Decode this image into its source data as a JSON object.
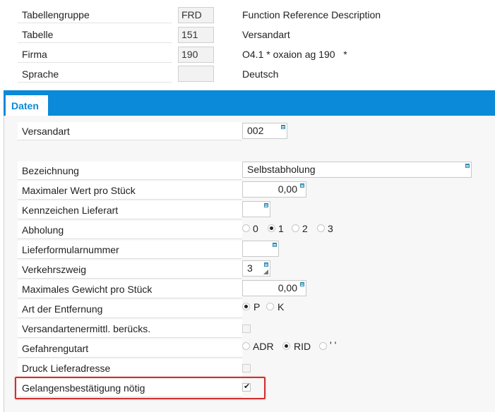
{
  "header": {
    "rows": [
      {
        "label": "Tabellengruppe",
        "value": "FRD",
        "text": "Function Reference Description"
      },
      {
        "label": "Tabelle",
        "value": "151",
        "text": "Versandart"
      },
      {
        "label": "Firma",
        "value": "190",
        "text": "O4.1 * oxaion ag 190   *"
      },
      {
        "label": "Sprache",
        "value": "",
        "text": "Deutsch"
      }
    ]
  },
  "tabs": [
    {
      "label": "Daten"
    }
  ],
  "accent_color": "#0a8ad8",
  "form": {
    "versandart": {
      "label": "Versandart",
      "value": "002"
    },
    "bezeichnung": {
      "label": "Bezeichnung",
      "value": "Selbstabholung"
    },
    "max_wert": {
      "label": "Maximaler Wert pro Stück",
      "value": "0,00"
    },
    "kennzeichen": {
      "label": "Kennzeichen Lieferart",
      "value": ""
    },
    "abholung": {
      "label": "Abholung",
      "options": [
        "0",
        "1",
        "2",
        "3"
      ],
      "selected": "1"
    },
    "lieferformular": {
      "label": "Lieferformularnummer",
      "value": ""
    },
    "verkehrszweig": {
      "label": "Verkehrszweig",
      "value": "3"
    },
    "max_gewicht": {
      "label": "Maximales Gewicht pro Stück",
      "value": "0,00"
    },
    "entfernung": {
      "label": "Art der Entfernung",
      "options": [
        "P",
        "K"
      ],
      "selected": "P"
    },
    "versandartenermittl": {
      "label": "Versandartenermittl. berücks.",
      "checked": false
    },
    "gefahrengut": {
      "label": "Gefahrengutart",
      "options": [
        "ADR",
        "RID",
        "' '"
      ],
      "selected": "RID"
    },
    "druck_liefer": {
      "label": "Druck Lieferadresse",
      "checked": false
    },
    "gelangens": {
      "label": "Gelangensbestätigung nötig",
      "checked": true
    }
  }
}
